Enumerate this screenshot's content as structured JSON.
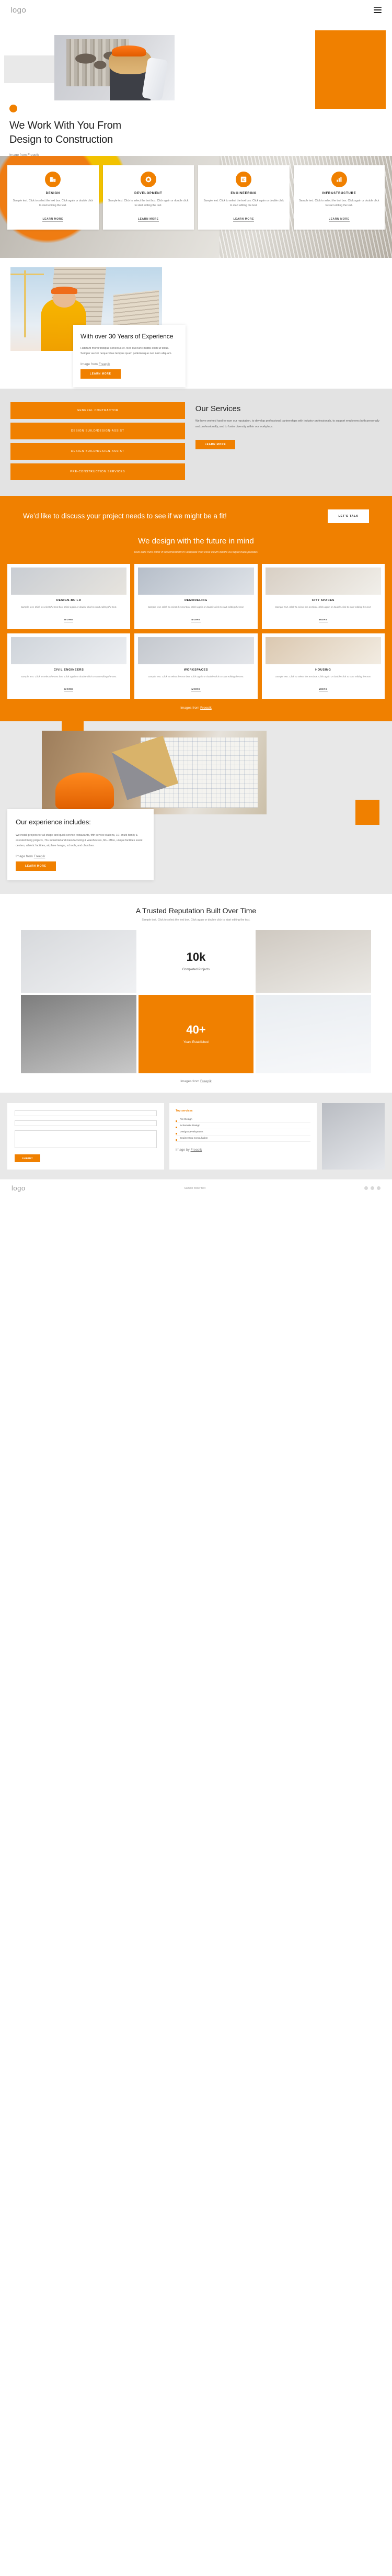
{
  "header": {
    "logo": "logo",
    "menu_icon": "hamburger-icon"
  },
  "hero": {
    "heading": "We Work With You From Design to Construction",
    "credit_prefix": "Image from ",
    "credit_link": "Freepik"
  },
  "services_strip": {
    "cards": [
      {
        "icon": "building-icon",
        "glyph": "Ἶ2",
        "title": "DESIGN",
        "body": "Sample text. Click to select the text box. Click again or double click to start editing the text.",
        "link": "LEARN MORE"
      },
      {
        "icon": "gear-home-icon",
        "glyph": "⚙",
        "title": "DEVELOPMENT",
        "body": "Sample text. Click to select the text box. Click again or double click to start editing the text.",
        "link": "LEARN MORE"
      },
      {
        "icon": "blueprint-icon",
        "glyph": "Ὅ0",
        "title": "ENGINEERING",
        "body": "Sample text. Click to select the text box. Click again or double click to start editing the text.",
        "link": "LEARN MORE"
      },
      {
        "icon": "chart-bars-icon",
        "glyph": "ὌA",
        "title": "INFRASTRUCTURE",
        "body": "Sample text. Click to select the text box. Click again or double click to start editing the text.",
        "link": "LEARN MORE"
      }
    ]
  },
  "experience": {
    "heading": "With over 30 Years of Experience",
    "body": "Habitant morbi tristique senectus et. Nec dui nunc mattis enim ut tellus. Semper auctor neque vitae tempus quam pellentesque nec nam aliquam.",
    "credit_prefix": "Image from ",
    "credit_link": "Freepik",
    "button": "LEARN MORE"
  },
  "our_services": {
    "buttons": [
      "GENERAL CONTRACTOR",
      "DESIGN BUILD/DESIGN-ASSIST",
      "DESIGN BUILD/DESIGN-ASSIST",
      "PRE-CONSTRUCTION SERVICES"
    ],
    "heading": "Our Services",
    "body": "We have worked hard to earn our reputation, to develop professional partnerships with industry professionals, to support employees both personally and professionally, and to foster diversity within our workplace.",
    "button": "LEARN MORE"
  },
  "cta": {
    "heading": "We’d like to discuss your project needs to see if we might be a fit!",
    "button": "LET'S TALK"
  },
  "portfolio": {
    "heading": "We design with the future in mind",
    "subheading": "Duis aute irure dolor in reprehenderit in voluptate velit esse cillum dolore eu fugiat nulla pariatur.",
    "cards": [
      {
        "title": "DESIGN-BUILD",
        "body": "Sample text. Click to select the text box. Click again or double click to start editing the text.",
        "link": "MORE"
      },
      {
        "title": "REMODELING",
        "body": "Sample text. Click to select the text box. Click again or double click to start editing the text.",
        "link": "MORE"
      },
      {
        "title": "CITY SPACES",
        "body": "Sample text. Click to select the text box. Click again or double click to start editing the text.",
        "link": "MORE"
      },
      {
        "title": "CIVIL ENGINEERS",
        "body": "Sample text. Click to select the text box. Click again or double click to start editing the text.",
        "link": "MORE"
      },
      {
        "title": "WORKSPACES",
        "body": "Sample text. Click to select the text box. Click again or double click to start editing the text.",
        "link": "MORE"
      },
      {
        "title": "HOUSING",
        "body": "Sample text. Click to select the text box. Click again or double click to start editing the text.",
        "link": "MORE"
      }
    ],
    "credit_prefix": "Images from ",
    "credit_link": "Freepik"
  },
  "includes": {
    "heading": "Our experience includes:",
    "body": "We install projects for all shape and quick service restaurants, fifth service stations, 10+ multi-family & assisted living projects, 70+ industrial and manufacturing & warehouses, 60+ office, unique facilities event centers, athletic facilities, airplane hangar, schools, and churches.",
    "credit_prefix": "Image from ",
    "credit_link": "Freepik",
    "button": "LEARN MORE"
  },
  "reputation": {
    "heading": "A Trusted Reputation Built Over Time",
    "subheading": "Sample text. Click to select the text box. Click again or double click to start editing the text.",
    "stats": [
      {
        "value": "10k",
        "label": "Completed Projects"
      },
      {
        "value": "40+",
        "label": "Years Established"
      }
    ],
    "credit_prefix": "Images from ",
    "credit_link": "Freepik"
  },
  "form": {
    "name_placeholder": "",
    "email_placeholder": "",
    "message_placeholder": "",
    "submit": "SUBMIT"
  },
  "list_card": {
    "title": "Top services",
    "items": [
      "Pre Design",
      "Schematic Design",
      "Design Development",
      "Engineering Consultation"
    ],
    "credit_prefix": "Image by ",
    "credit_link": "Freepik"
  },
  "footer": {
    "logo": "logo",
    "text": "Sample footer text"
  },
  "colors": {
    "accent": "#f08000",
    "page_gray": "#e3e3e3",
    "dark": "#1f1f1f"
  }
}
